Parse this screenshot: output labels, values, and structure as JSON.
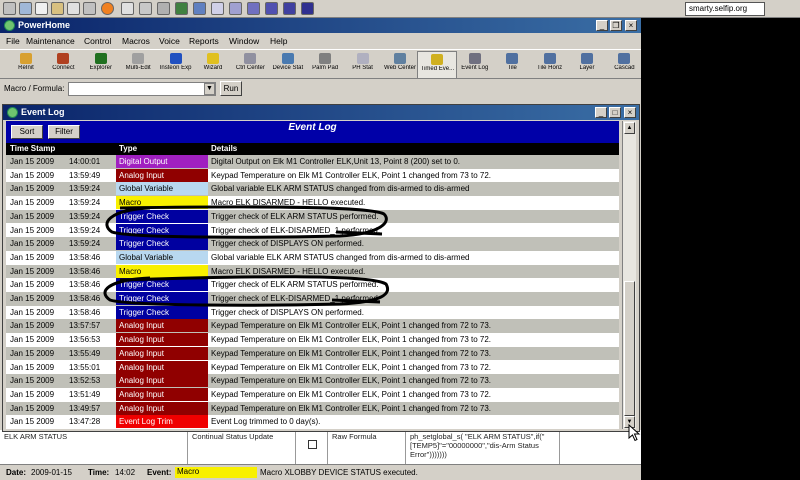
{
  "browser": {
    "url": "smarty.selfip.org"
  },
  "app": {
    "title": "PowerHome",
    "menus": [
      "File",
      "Maintenance",
      "Control",
      "Macros",
      "Voice",
      "Reports",
      "Window",
      "Help"
    ],
    "toolbar": [
      {
        "label": "ReInit",
        "icon": "reinit-icon",
        "color": "#d8a030"
      },
      {
        "label": "Connect",
        "icon": "connect-icon",
        "color": "#b04020"
      },
      {
        "label": "Explorer",
        "icon": "explorer-icon",
        "color": "#207020"
      },
      {
        "label": "Multi-Edit",
        "icon": "multi-edit-icon",
        "color": "#a0a0a0"
      },
      {
        "label": "Insteon Exp",
        "icon": "insteon-icon",
        "color": "#2050c0"
      },
      {
        "label": "Wizard",
        "icon": "wizard-icon",
        "color": "#e0c020"
      },
      {
        "label": "Ctrl Center",
        "icon": "ctrl-center-icon",
        "color": "#9090a0"
      },
      {
        "label": "Device Stat",
        "icon": "device-stat-icon",
        "color": "#4a7ab0"
      },
      {
        "label": "Palm Pad",
        "icon": "palm-pad-icon",
        "color": "#808080"
      },
      {
        "label": "PH Stat",
        "icon": "ph-stat-icon",
        "color": "#b0b0c0"
      },
      {
        "label": "Web Center",
        "icon": "web-center-icon",
        "color": "#6080a0"
      },
      {
        "label": "Timed Eve...",
        "icon": "timed-events-icon",
        "color": "#d0b020"
      },
      {
        "label": "Event Log",
        "icon": "event-log-icon",
        "color": "#707080"
      },
      {
        "label": "Tile",
        "icon": "tile-icon",
        "color": "#5070a0"
      },
      {
        "label": "Tile Horiz",
        "icon": "tile-horiz-icon",
        "color": "#5070a0"
      },
      {
        "label": "Layer",
        "icon": "layer-icon",
        "color": "#5070a0"
      },
      {
        "label": "Cascad",
        "icon": "cascade-icon",
        "color": "#5070a0"
      }
    ],
    "formula_label": "Macro / Formula:",
    "formula_value": "",
    "run_label": "Run"
  },
  "background_window": {
    "cells": [
      "ELK ARM STATUS",
      "Continual Status Update",
      "",
      "Raw Formula",
      "ph_setglobal_s( \"ELK ARM STATUS\",if(\"[TEMP5]\"=\"00000000\",\"dis-Arm Status Error\")))))))"
    ]
  },
  "status": {
    "date_label": "Date:",
    "date": "2009-01-15",
    "time_label": "Time:",
    "time": "14:02",
    "event_label": "Event:",
    "event_type": "Macro",
    "event_text": "Macro XLOBBY DEVICE STATUS executed."
  },
  "event_log": {
    "window_title": "Event Log",
    "header_title": "Event Log",
    "sort_label": "Sort",
    "filter_label": "Filter",
    "columns": [
      "Time Stamp",
      "Type",
      "Details"
    ],
    "type_colors": {
      "Digital Output": {
        "bg": "#a020c0",
        "fg": "#ffffff"
      },
      "Analog Input": {
        "bg": "#900000",
        "fg": "#ffffff"
      },
      "Global Variable": {
        "bg": "#b8d8f0",
        "fg": "#000000"
      },
      "Macro": {
        "bg": "#f8f000",
        "fg": "#000000"
      },
      "Trigger Check": {
        "bg": "#0000a0",
        "fg": "#ffffff"
      },
      "Event Log Trim": {
        "bg": "#f00000",
        "fg": "#ffffff"
      }
    },
    "rows": [
      {
        "date": "Jan  15  2009",
        "time": "14:00:01",
        "type": "Digital Output",
        "details": "Digital Output on Elk M1 Controller ELK,Unit 13, Point 8 (200) set to 0."
      },
      {
        "date": "Jan  15  2009",
        "time": "13:59:49",
        "type": "Analog Input",
        "details": "Keypad Temperature on Elk M1 Controller ELK, Point 1 changed from 73 to 72."
      },
      {
        "date": "Jan  15  2009",
        "time": "13:59:24",
        "type": "Global Variable",
        "details": "Global variable ELK ARM STATUS changed from dis-armed to dis-armed"
      },
      {
        "date": "Jan  15  2009",
        "time": "13:59:24",
        "type": "Macro",
        "details": "Macro ELK DISARMED - HELLO executed."
      },
      {
        "date": "Jan  15  2009",
        "time": "13:59:24",
        "type": "Trigger Check",
        "details": "Trigger check of ELK ARM STATUS performed."
      },
      {
        "date": "Jan  15  2009",
        "time": "13:59:24",
        "type": "Trigger Check",
        "details": "Trigger check of ELK-DISARMED_1 performed."
      },
      {
        "date": "Jan  15  2009",
        "time": "13:59:24",
        "type": "Trigger Check",
        "details": "Trigger check of DISPLAYS ON performed."
      },
      {
        "date": "Jan  15  2009",
        "time": "13:58:46",
        "type": "Global Variable",
        "details": "Global variable ELK ARM STATUS changed from dis-armed to dis-armed"
      },
      {
        "date": "Jan  15  2009",
        "time": "13:58:46",
        "type": "Macro",
        "details": "Macro ELK DISARMED - HELLO executed."
      },
      {
        "date": "Jan  15  2009",
        "time": "13:58:46",
        "type": "Trigger Check",
        "details": "Trigger check of ELK ARM STATUS performed."
      },
      {
        "date": "Jan  15  2009",
        "time": "13:58:46",
        "type": "Trigger Check",
        "details": "Trigger check of ELK-DISARMED_1 performed."
      },
      {
        "date": "Jan  15  2009",
        "time": "13:58:46",
        "type": "Trigger Check",
        "details": "Trigger check of DISPLAYS ON performed."
      },
      {
        "date": "Jan  15  2009",
        "time": "13:57:57",
        "type": "Analog Input",
        "details": "Keypad Temperature on Elk M1 Controller ELK, Point 1 changed from 72 to 73."
      },
      {
        "date": "Jan  15  2009",
        "time": "13:56:53",
        "type": "Analog Input",
        "details": "Keypad Temperature on Elk M1 Controller ELK, Point 1 changed from 73 to 72."
      },
      {
        "date": "Jan  15  2009",
        "time": "13:55:49",
        "type": "Analog Input",
        "details": "Keypad Temperature on Elk M1 Controller ELK, Point 1 changed from 72 to 73."
      },
      {
        "date": "Jan  15  2009",
        "time": "13:55:01",
        "type": "Analog Input",
        "details": "Keypad Temperature on Elk M1 Controller ELK, Point 1 changed from 73 to 72."
      },
      {
        "date": "Jan  15  2009",
        "time": "13:52:53",
        "type": "Analog Input",
        "details": "Keypad Temperature on Elk M1 Controller ELK, Point 1 changed from 72 to 73."
      },
      {
        "date": "Jan  15  2009",
        "time": "13:51:49",
        "type": "Analog Input",
        "details": "Keypad Temperature on Elk M1 Controller ELK, Point 1 changed from 73 to 72."
      },
      {
        "date": "Jan  15  2009",
        "time": "13:49:57",
        "type": "Analog Input",
        "details": "Keypad Temperature on Elk M1 Controller ELK, Point 1 changed from 72 to 73."
      },
      {
        "date": "Jan  15  2009",
        "time": "13:47:28",
        "type": "Event Log Trim",
        "details": "Event Log trimmed to 0 day(s)."
      }
    ]
  }
}
